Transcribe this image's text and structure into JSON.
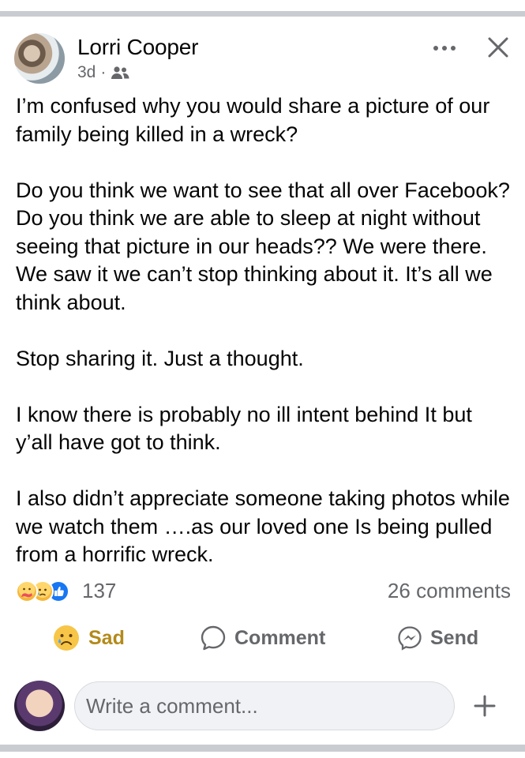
{
  "post": {
    "author": "Lorri Cooper",
    "age": "3d",
    "separator": "·",
    "audience_icon": "friends-icon",
    "paragraphs": [
      "I’m confused why you would share a picture of our family being killed in a wreck?",
      "Do you think we want to see that all over Facebook? Do you think we are able to sleep at night without seeing that picture in our heads?? We were there. We saw it we can’t stop thinking about it. It’s all we think about.",
      "Stop sharing it. Just a thought.",
      "I know there is probably no ill intent behind It but y’all have got to think.",
      "I also didn’t appreciate someone taking photos while we watch them ….as our loved one Is being pulled from a horrific wreck."
    ]
  },
  "reactions": {
    "icons": [
      "care-reaction-icon",
      "sad-reaction-icon",
      "like-reaction-icon"
    ],
    "count": "137",
    "comments": "26 comments"
  },
  "actions": {
    "sad_label": "Sad",
    "comment_label": "Comment",
    "send_label": "Send"
  },
  "composer": {
    "placeholder": "Write a comment..."
  },
  "colors": {
    "divider": "#c9ccd1",
    "muted_text": "#65676b",
    "sad_accent": "#b38a1a",
    "like_blue": "#1877f2",
    "input_bg": "#f0f2f5"
  }
}
